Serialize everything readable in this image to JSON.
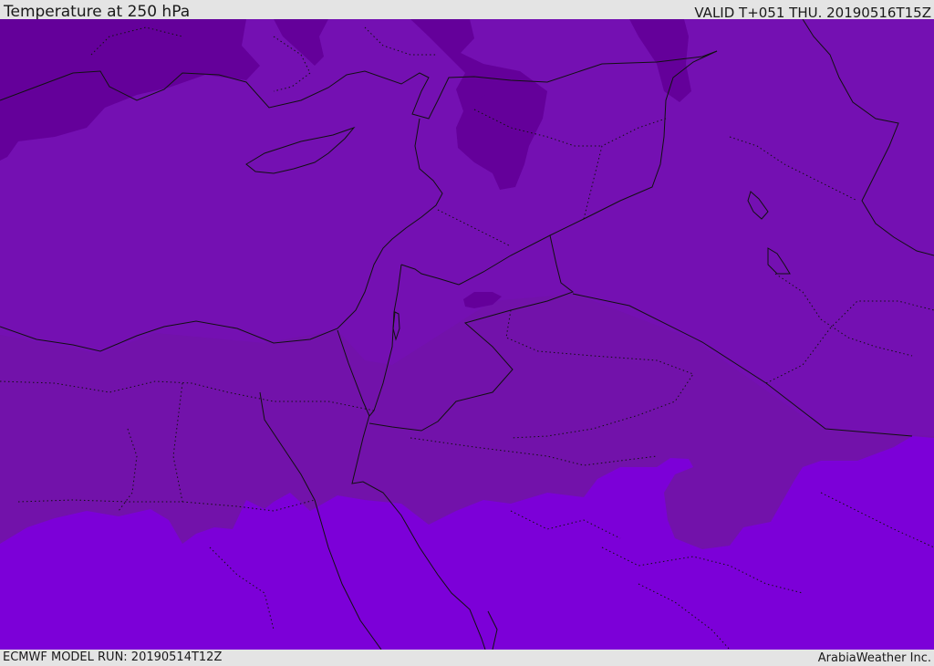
{
  "header": {
    "title": "Temperature at 250 hPa",
    "valid_time": "VALID T+051 THU. 20190516T15Z"
  },
  "footer": {
    "model_run": "ECMWF MODEL RUN: 20190514T12Z",
    "credit": "ArabiaWeather Inc."
  },
  "map": {
    "variable": "temperature",
    "pressure_level": "250 hPa",
    "colors": {
      "coldest": "#64009a",
      "cold": "#7410b2",
      "mid": "#7312ac",
      "warm": "#7c00d8",
      "boundaries": "#111111"
    }
  }
}
